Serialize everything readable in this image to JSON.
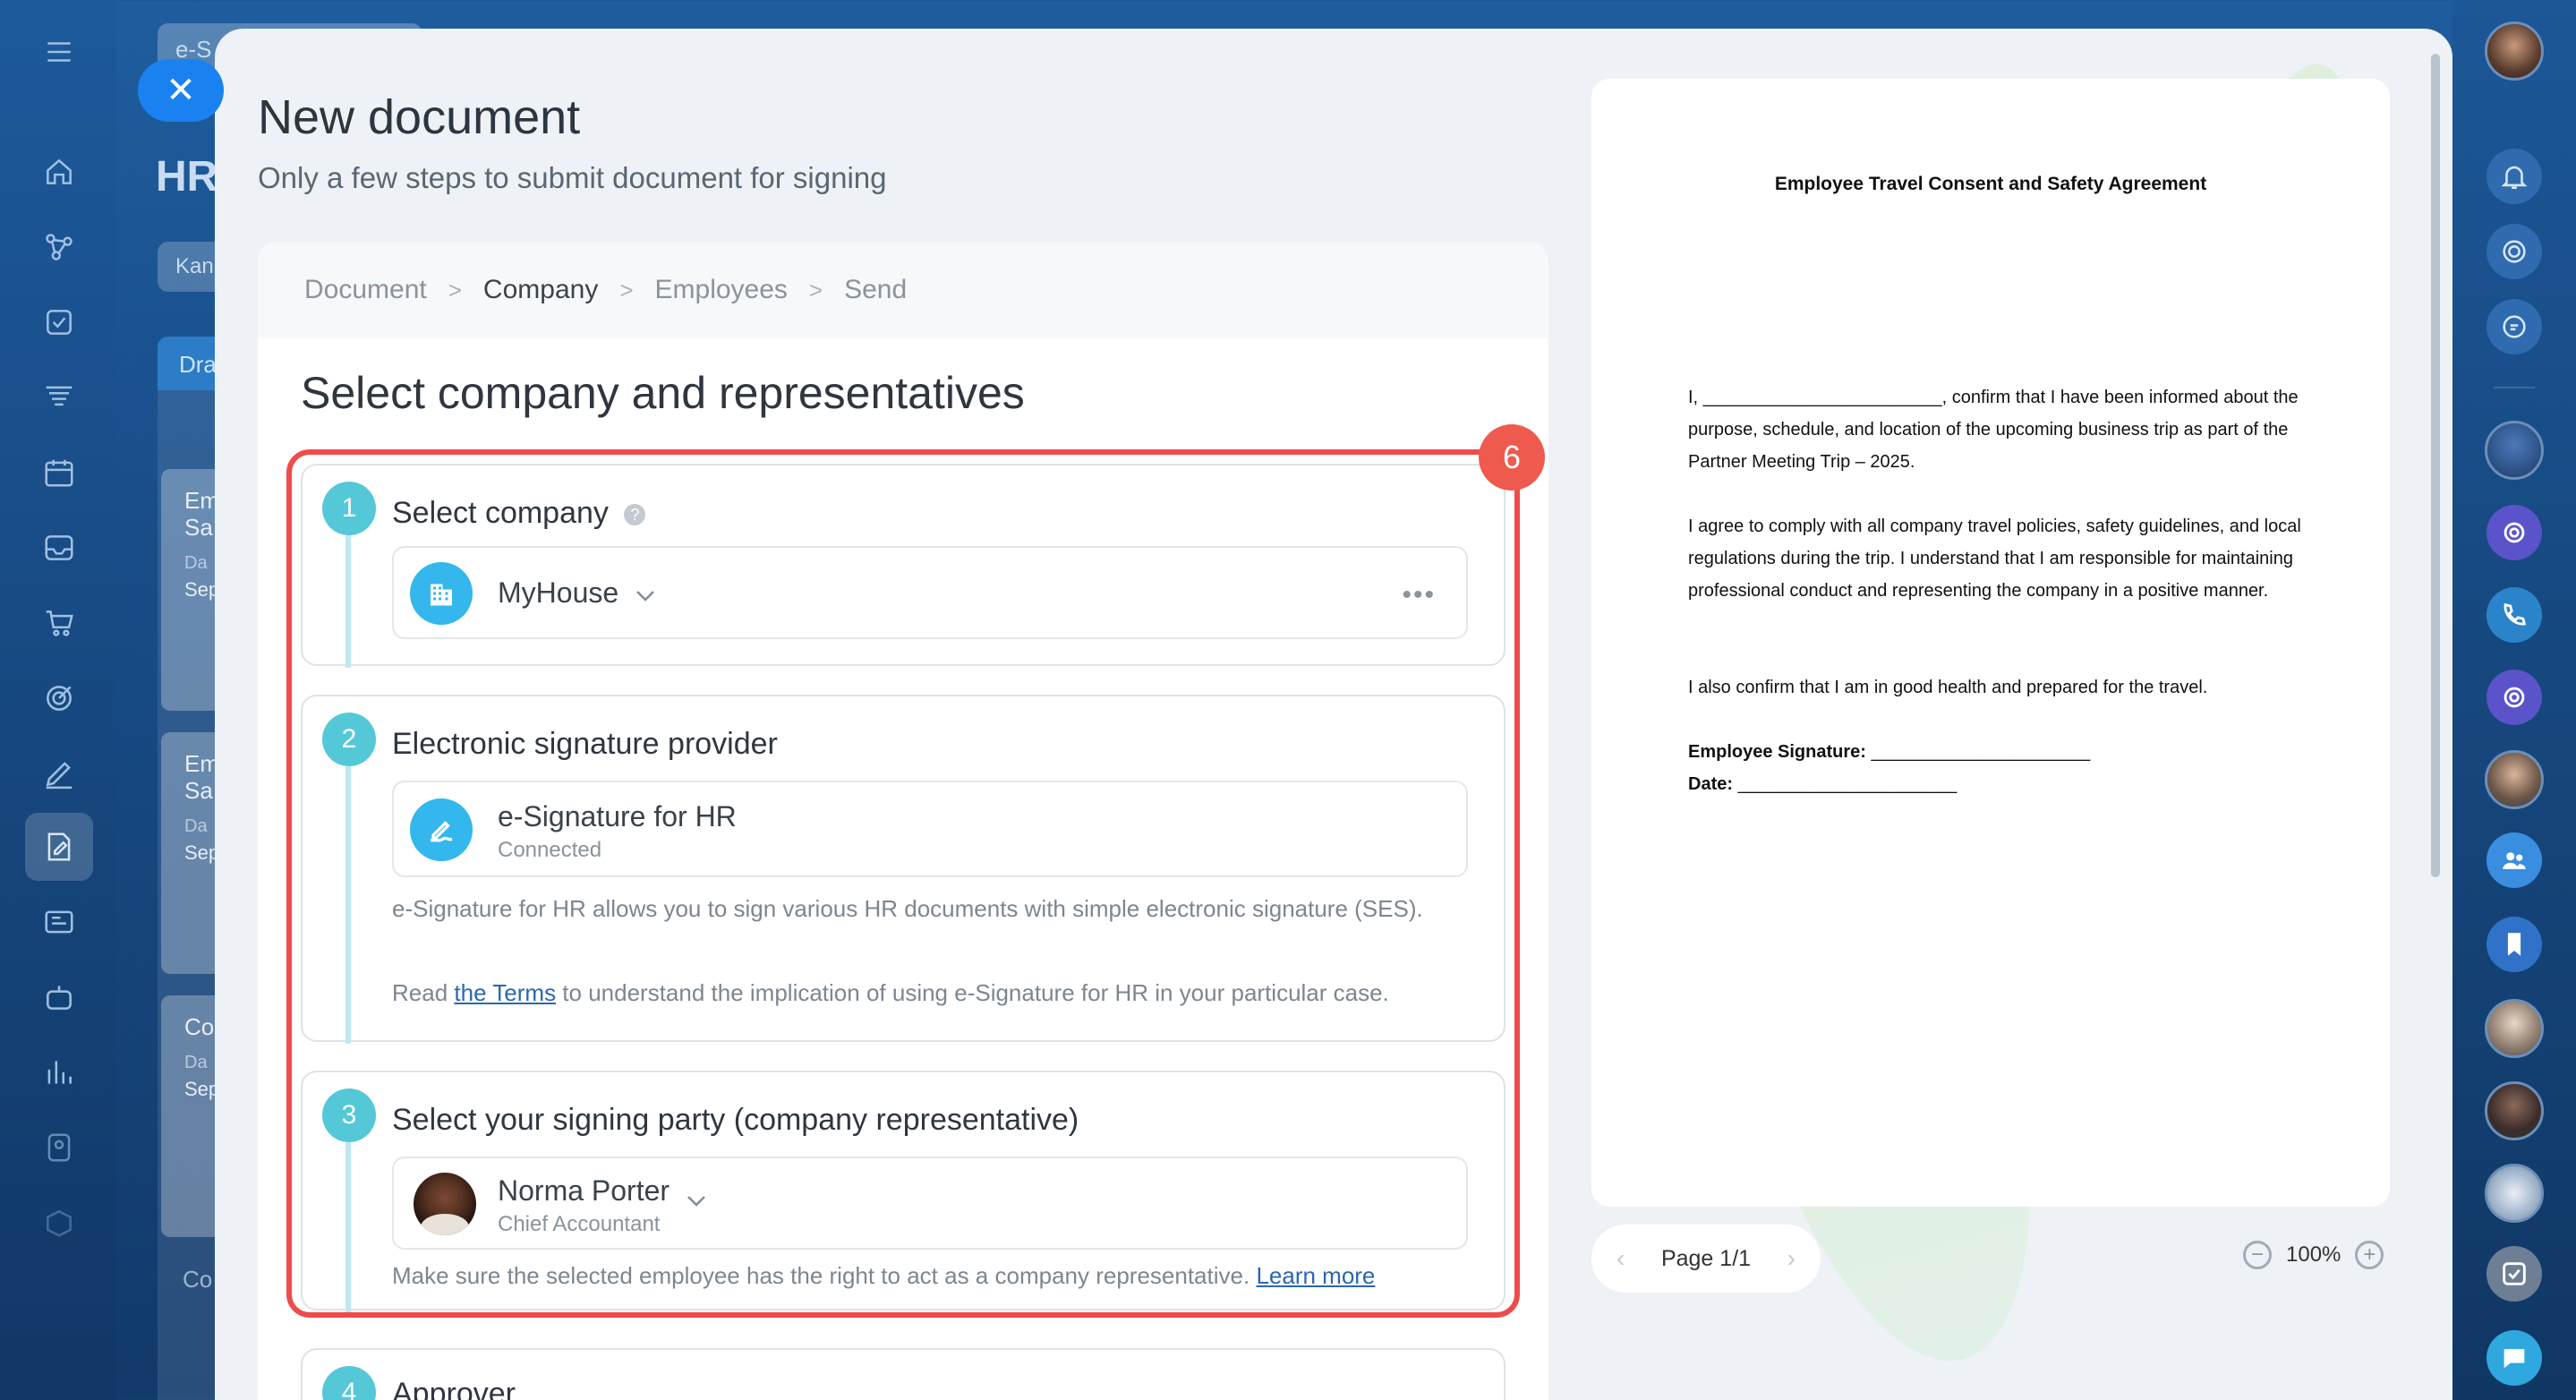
{
  "background": {
    "tab_label": "e-S",
    "title": "HR",
    "chip_label": "Kan",
    "column_header": "Dra",
    "cards": [
      {
        "line1": "Em",
        "line2": "Sa",
        "line3": "Da",
        "line4": "Sep"
      },
      {
        "line1": "Em",
        "line2": "Sa",
        "line3": "Da",
        "line4": "Sep"
      },
      {
        "line1": "Co",
        "line2": "",
        "line3": "Da",
        "line4": "Sep"
      }
    ],
    "bottom_label": "Co"
  },
  "modal": {
    "title": "New document",
    "subtitle": "Only a few steps to submit document for signing"
  },
  "wizard": {
    "steps": [
      "Document",
      "Company",
      "Employees",
      "Send"
    ],
    "current_step": "Company",
    "section_title": "Select company and representatives",
    "annotation_badge": "6"
  },
  "step1": {
    "number": "1",
    "title": "Select company",
    "company_name": "MyHouse"
  },
  "step2": {
    "number": "2",
    "title": "Electronic signature provider",
    "provider_name": "e-Signature for HR",
    "provider_status": "Connected",
    "description": "e-Signature for HR allows you to sign various HR documents with simple electronic signature (SES).",
    "terms_prefix": "Read ",
    "terms_link": "the Terms",
    "terms_suffix": " to understand the implication of using e-Signature for HR in your particular case."
  },
  "step3": {
    "number": "3",
    "title": "Select your signing party (company representative)",
    "rep_name": "Norma Porter",
    "rep_role": "Chief Accountant",
    "hint": "Make sure the selected employee has the right to act as a company representative.",
    "learn_more": "Learn more"
  },
  "step4": {
    "number": "4",
    "title": "Approver"
  },
  "preview": {
    "doc_title": "Employee Travel Consent and Safety Agreement",
    "para1": "I, ________________________, confirm that I have been informed about the purpose, schedule, and location of the upcoming business trip as part of the Partner Meeting Trip – 2025.",
    "para2": "I agree to comply with all company travel policies, safety guidelines, and local regulations during the trip. I understand that I am responsible for maintaining professional conduct and representing the company in a positive manner.",
    "para3": "I also confirm that I am in good health and prepared for the travel.",
    "sig_label": "Employee Signature:",
    "sig_line": " ______________________",
    "date_label": "Date:",
    "date_line": " ______________________",
    "page_label": "Page 1/1",
    "zoom_level": "100%"
  },
  "icons": {
    "close": "close-icon",
    "menu": "hamburger-icon",
    "help": "help-icon",
    "chevron": "chevron-down-icon",
    "more": "more-horizontal-icon"
  },
  "colors": {
    "accent": "#1a82f0",
    "step_teal": "#55c8d8",
    "highlight_red": "#ef4b4b",
    "link_blue": "#2a67b1"
  }
}
